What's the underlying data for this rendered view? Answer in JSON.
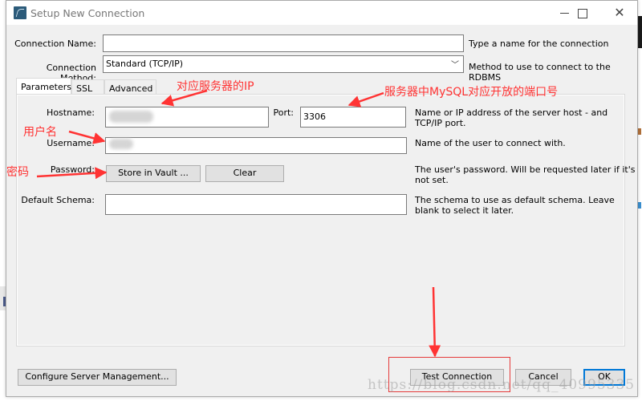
{
  "window": {
    "title": "Setup New Connection",
    "controls": {
      "minimize": "minimize",
      "maximize": "maximize",
      "close": "close"
    }
  },
  "form": {
    "connection_name": {
      "label": "Connection Name:",
      "value": "",
      "help": "Type a name for the connection"
    },
    "connection_method": {
      "label": "Connection Method:",
      "value": "Standard (TCP/IP)",
      "help": "Method to use to connect to the RDBMS"
    }
  },
  "tabs": [
    {
      "label": "Parameters",
      "active": true
    },
    {
      "label": "SSL",
      "active": false
    },
    {
      "label": "Advanced",
      "active": false
    }
  ],
  "parameters": {
    "hostname": {
      "label": "Hostname:",
      "value": "",
      "help_line1": "Name or IP address of the server host - and",
      "help_line2": "TCP/IP port."
    },
    "port": {
      "label": "Port:",
      "value": "3306"
    },
    "username": {
      "label": "Username:",
      "value": "",
      "help": "Name of the user to connect with."
    },
    "password": {
      "label": "Password:",
      "store_button": "Store in Vault ...",
      "clear_button": "Clear",
      "help_line1": "The user's password. Will be requested later if it's",
      "help_line2": "not set."
    },
    "default_schema": {
      "label": "Default Schema:",
      "value": "",
      "help_line1": "The schema to use as default schema. Leave",
      "help_line2": "blank to select it later."
    }
  },
  "footer": {
    "configure_button": "Configure Server Management...",
    "test_button": "Test Connection",
    "cancel_button": "Cancel",
    "ok_button": "OK"
  },
  "annotations": {
    "hostname_note": "对应服务器的IP",
    "port_note": "服务器中MySQL对应开放的端口号",
    "username_note": "用户名",
    "password_note": "密码",
    "color": "#ff3333"
  },
  "watermark": "https://blog.csdn.net/qq_40995335"
}
